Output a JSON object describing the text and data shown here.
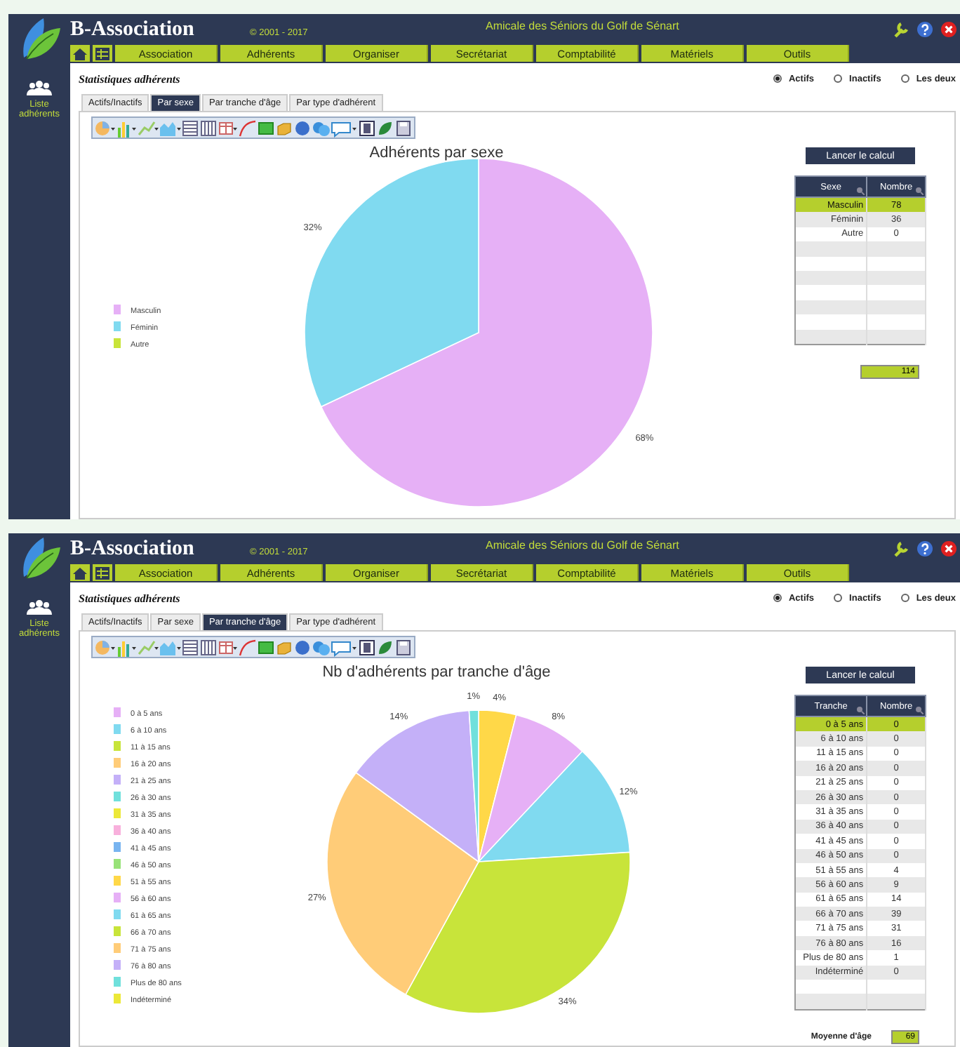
{
  "screens": [
    {
      "header": {
        "app_title": "B-Association",
        "copyright": "© 2001 - 2017",
        "organization": "Amicale des Séniors du Golf de Sénart"
      },
      "menu": [
        "Association",
        "Adhérents",
        "Organiser",
        "Secrétariat",
        "Comptabilité",
        "Matériels",
        "Outils"
      ],
      "sidebar": {
        "items": [
          {
            "label": "Liste adhérents"
          }
        ]
      },
      "page_title": "Statistiques adhérents",
      "status_filter": [
        {
          "label": "Actifs",
          "selected": true
        },
        {
          "label": "Inactifs",
          "selected": false
        },
        {
          "label": "Les deux",
          "selected": false
        }
      ],
      "tabs": [
        {
          "label": "Actifs/Inactifs",
          "selected": false
        },
        {
          "label": "Par sexe",
          "selected": true
        },
        {
          "label": "Par tranche d'âge",
          "selected": false
        },
        {
          "label": "Par type d'adhérent",
          "selected": false
        }
      ],
      "chart_data": {
        "type": "pie",
        "title": "Adhérents par sexe",
        "categories": [
          "Masculin",
          "Féminin",
          "Autre"
        ],
        "values": [
          68,
          32,
          0
        ],
        "colors": [
          "#e6b0f6",
          "#80daf0",
          "#c8e43a"
        ],
        "data_labels": true,
        "value_labels": [
          "68%",
          "32%",
          null
        ],
        "legend": "left"
      },
      "calculate_button": "Lancer le calcul",
      "table": {
        "columns": [
          "Sexe",
          "Nombre"
        ],
        "rows": [
          {
            "cells": [
              "Masculin",
              "78"
            ],
            "selected": true
          },
          {
            "cells": [
              "Féminin",
              "36"
            ],
            "selected": false
          },
          {
            "cells": [
              "Autre",
              "0"
            ],
            "selected": false
          }
        ]
      },
      "summary": {
        "value": "114"
      }
    },
    {
      "header": {
        "app_title": "B-Association",
        "copyright": "© 2001 - 2017",
        "organization": "Amicale des Séniors du Golf de Sénart"
      },
      "menu": [
        "Association",
        "Adhérents",
        "Organiser",
        "Secrétariat",
        "Comptabilité",
        "Matériels",
        "Outils"
      ],
      "sidebar": {
        "items": [
          {
            "label": "Liste adhérents"
          }
        ]
      },
      "page_title": "Statistiques adhérents",
      "status_filter": [
        {
          "label": "Actifs",
          "selected": true
        },
        {
          "label": "Inactifs",
          "selected": false
        },
        {
          "label": "Les deux",
          "selected": false
        }
      ],
      "tabs": [
        {
          "label": "Actifs/Inactifs",
          "selected": false
        },
        {
          "label": "Par sexe",
          "selected": false
        },
        {
          "label": "Par tranche d'âge",
          "selected": true
        },
        {
          "label": "Par type d'adhérent",
          "selected": false
        }
      ],
      "chart_data": {
        "type": "pie",
        "title": "Nb d'adhérents par tranche d'âge",
        "categories": [
          "0 à 5 ans",
          "6 à 10 ans",
          "11 à 15 ans",
          "16 à 20 ans",
          "21 à 25 ans",
          "26 à 30 ans",
          "31 à 35 ans",
          "36 à 40 ans",
          "41 à 45 ans",
          "46 à 50 ans",
          "51 à 55 ans",
          "56 à 60 ans",
          "61 à 65 ans",
          "66 à 70 ans",
          "71 à 75 ans",
          "76 à 80 ans",
          "Plus de 80 ans",
          "Indéterminé"
        ],
        "values": [
          0,
          0,
          0,
          0,
          0,
          0,
          0,
          0,
          0,
          0,
          4,
          8,
          12,
          34,
          27,
          14,
          1,
          0
        ],
        "colors": [
          "#e6b0f6",
          "#80daf0",
          "#c8e43a",
          "#ffcc78",
          "#c4b0f8",
          "#70e0dc",
          "#ece838",
          "#f8b0dc",
          "#78b4f0",
          "#98e278",
          "#ffd848",
          "#e6b0f6",
          "#80daf0",
          "#c8e43a",
          "#ffcc78",
          "#c4b0f8",
          "#70e0dc",
          "#ece838"
        ],
        "data_labels": true,
        "value_labels": [
          null,
          null,
          null,
          null,
          null,
          null,
          null,
          null,
          null,
          null,
          "4%",
          "8%",
          "12%",
          "34%",
          "27%",
          "14%",
          "1%",
          null
        ],
        "legend": "left"
      },
      "calculate_button": "Lancer le calcul",
      "table": {
        "columns": [
          "Tranche",
          "Nombre"
        ],
        "rows": [
          {
            "cells": [
              "0 à 5 ans",
              "0"
            ],
            "selected": true
          },
          {
            "cells": [
              "6 à 10 ans",
              "0"
            ],
            "selected": false
          },
          {
            "cells": [
              "11 à 15 ans",
              "0"
            ],
            "selected": false
          },
          {
            "cells": [
              "16 à 20 ans",
              "0"
            ],
            "selected": false
          },
          {
            "cells": [
              "21 à 25 ans",
              "0"
            ],
            "selected": false
          },
          {
            "cells": [
              "26 à 30 ans",
              "0"
            ],
            "selected": false
          },
          {
            "cells": [
              "31 à 35 ans",
              "0"
            ],
            "selected": false
          },
          {
            "cells": [
              "36 à 40 ans",
              "0"
            ],
            "selected": false
          },
          {
            "cells": [
              "41 à 45 ans",
              "0"
            ],
            "selected": false
          },
          {
            "cells": [
              "46 à 50 ans",
              "0"
            ],
            "selected": false
          },
          {
            "cells": [
              "51 à 55 ans",
              "4"
            ],
            "selected": false
          },
          {
            "cells": [
              "56 à 60 ans",
              "9"
            ],
            "selected": false
          },
          {
            "cells": [
              "61 à 65 ans",
              "14"
            ],
            "selected": false
          },
          {
            "cells": [
              "66 à 70 ans",
              "39"
            ],
            "selected": false
          },
          {
            "cells": [
              "71 à 75 ans",
              "31"
            ],
            "selected": false
          },
          {
            "cells": [
              "76 à 80 ans",
              "16"
            ],
            "selected": false
          },
          {
            "cells": [
              "Plus de 80 ans",
              "1"
            ],
            "selected": false
          },
          {
            "cells": [
              "Indéterminé",
              "0"
            ],
            "selected": false
          }
        ]
      },
      "summary": {
        "label": "Moyenne d'âge",
        "value": "69"
      }
    }
  ]
}
